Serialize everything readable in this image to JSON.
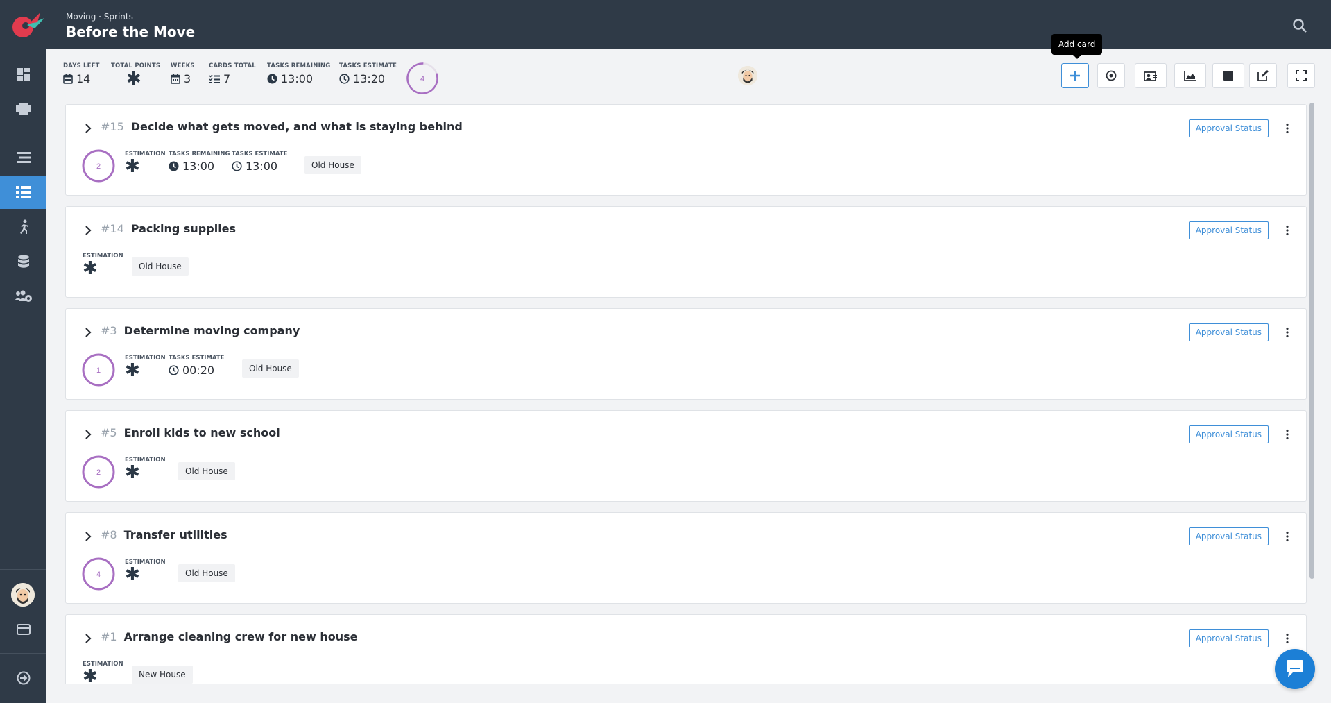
{
  "header": {
    "breadcrumb": "Moving · Sprints",
    "title": "Before the Move"
  },
  "stats": {
    "days_left": {
      "label": "DAYS LEFT",
      "value": "14"
    },
    "total_points": {
      "label": "TOTAL POINTS",
      "value": "✱"
    },
    "weeks": {
      "label": "WEEKS",
      "value": "3"
    },
    "cards_total": {
      "label": "CARDS TOTAL",
      "value": "7"
    },
    "tasks_remaining": {
      "label": "TASKS REMAINING",
      "value": "13:00"
    },
    "tasks_estimate": {
      "label": "TASKS ESTIMATE",
      "value": "13:20"
    },
    "progress_ring_value": "4"
  },
  "toolbar": {
    "tooltip": "Add card",
    "buttons": [
      "add-icon",
      "target-icon",
      "assign-icon",
      "chart-icon",
      "stop-icon",
      "edit-icon",
      "fullscreen-icon"
    ]
  },
  "colors": {
    "sidebar_bg": "#2f3a47",
    "accent_blue": "#3f8fd8",
    "ring_purple": "#a86fc2"
  },
  "cards": [
    {
      "num": "#15",
      "title": "Decide what gets moved, and what is staying behind",
      "ring": "2",
      "estimation_label": "ESTIMATION",
      "remaining_label": "TASKS REMAINING",
      "remaining": "13:00",
      "estimate_label": "TASKS ESTIMATE",
      "estimate": "13:00",
      "tag": "Old House",
      "approval": "Approval Status"
    },
    {
      "num": "#14",
      "title": "Packing supplies",
      "estimation_label": "ESTIMATION",
      "tag": "Old House",
      "approval": "Approval Status"
    },
    {
      "num": "#3",
      "title": "Determine moving company",
      "ring": "1",
      "estimation_label": "ESTIMATION",
      "estimate_label": "TASKS ESTIMATE",
      "estimate": "00:20",
      "tag": "Old House",
      "approval": "Approval Status"
    },
    {
      "num": "#5",
      "title": "Enroll kids to new school",
      "ring": "2",
      "estimation_label": "ESTIMATION",
      "tag": "Old House",
      "approval": "Approval Status"
    },
    {
      "num": "#8",
      "title": "Transfer utilities",
      "ring": "4",
      "estimation_label": "ESTIMATION",
      "tag": "Old House",
      "approval": "Approval Status"
    },
    {
      "num": "#1",
      "title": "Arrange cleaning crew for new house",
      "estimation_label": "ESTIMATION",
      "tag": "New House",
      "approval": "Approval Status"
    }
  ]
}
